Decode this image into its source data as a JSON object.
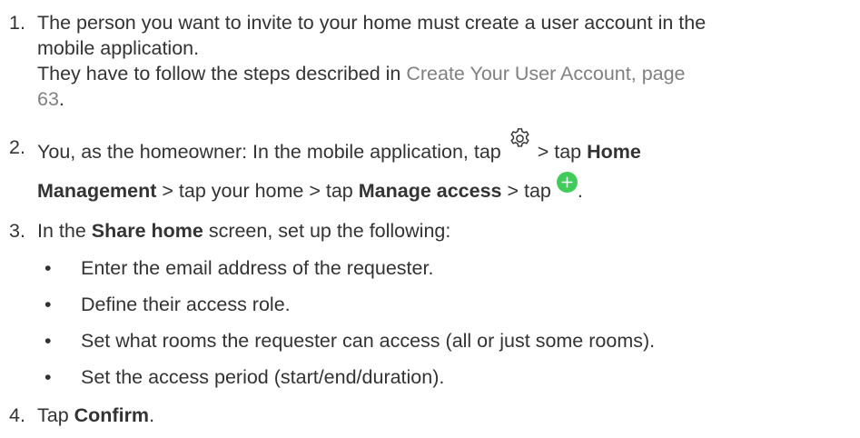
{
  "steps": {
    "s1": {
      "number": "1.",
      "line1": "The person you want to invite to your home must create a user account in the",
      "line2": "mobile application.",
      "line3": "They have to follow the steps described in ",
      "link_part1": "Create Your User Account, page",
      "link_part2": "63",
      "period": "."
    },
    "s2": {
      "number": "2.",
      "text1": "You, as the homeowner: In the mobile application, tap ",
      "text2": " > tap ",
      "bold_home": "Home",
      "bold_management": "Management",
      "text3": " > tap your home > tap ",
      "bold_manage_access": "Manage access",
      "text4": " > tap ",
      "period": ".",
      "gear_icon": "settings-gear-icon",
      "plus_icon": "add-plus-circle-icon",
      "plus_color": "#3dcd58"
    },
    "s3": {
      "number": "3.",
      "text1": "In the ",
      "bold_share_home": "Share home",
      "text2": " screen, set up the following:",
      "bullets": [
        "Enter the email address of the requester.",
        "Define their access role.",
        "Set what rooms the requester can access (all or just some rooms).",
        "Set the access period (start/end/duration)."
      ],
      "bullet_symbol": "•"
    },
    "s4": {
      "number": "4.",
      "text1": "Tap ",
      "bold_confirm": "Confirm",
      "period": "."
    }
  }
}
